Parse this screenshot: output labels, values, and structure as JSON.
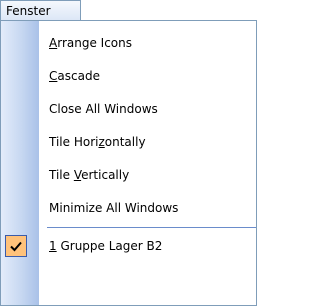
{
  "menu": {
    "title": "Fenster",
    "items": [
      {
        "pre": "",
        "ul": "A",
        "post": "rrange Icons"
      },
      {
        "pre": "",
        "ul": "C",
        "post": "ascade"
      },
      {
        "pre": "Close All Windows",
        "ul": "",
        "post": ""
      },
      {
        "pre": "Tile Hori",
        "ul": "z",
        "post": "ontally"
      },
      {
        "pre": "Tile ",
        "ul": "V",
        "post": "ertically"
      },
      {
        "pre": "Minimize All Windows",
        "ul": "",
        "post": ""
      }
    ],
    "window_item": {
      "pre": "",
      "ul": "1",
      "post": " Gruppe Lager B2",
      "checked": true
    }
  },
  "colors": {
    "gutter": "#c6d7f1",
    "border": "#7f9db9",
    "check_background": "#ffc27a",
    "check_border": "#3a5ba9"
  },
  "icons": {
    "check": "checkmark-icon"
  }
}
